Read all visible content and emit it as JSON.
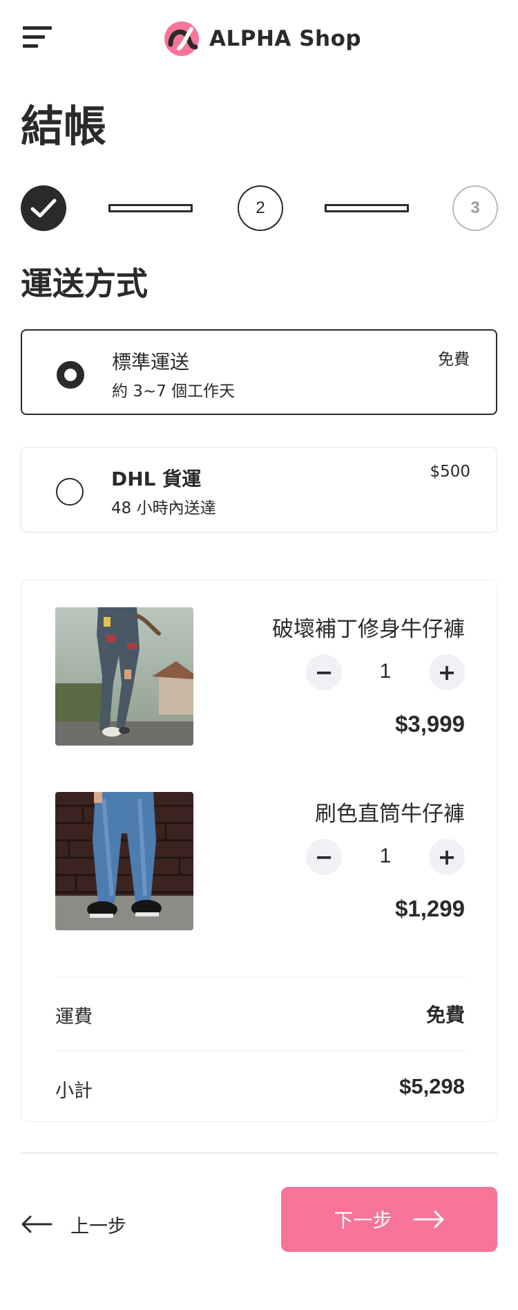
{
  "header": {
    "brand": "ALPHA Shop",
    "menu_icon": "hamburger-menu-icon",
    "logo_icon": "alpha-logo-icon",
    "logo_color": "#f67599"
  },
  "page_title": "結帳",
  "stepper": {
    "steps": [
      {
        "label": "",
        "state": "completed",
        "icon": "check-icon"
      },
      {
        "label": "2",
        "state": "current"
      },
      {
        "label": "3",
        "state": "upcoming"
      }
    ]
  },
  "shipping": {
    "title": "運送方式",
    "options": [
      {
        "name": "標準運送",
        "desc": "約 3~7 個工作天",
        "price": "免費",
        "selected": true
      },
      {
        "name": "DHL 貨運",
        "desc": "48 小時內送達",
        "price": "$500",
        "selected": false
      }
    ]
  },
  "cart": {
    "items": [
      {
        "name": "破壞補丁修身牛仔褲",
        "qty": "1",
        "price": "$3,999",
        "minus": "−",
        "plus": "+"
      },
      {
        "name": "刷色直筒牛仔褲",
        "qty": "1",
        "price": "$1,299",
        "minus": "−",
        "plus": "+"
      }
    ],
    "shipping_label": "運費",
    "shipping_value": "免費",
    "subtotal_label": "小計",
    "subtotal_value": "$5,298"
  },
  "nav": {
    "prev_label": "上一步",
    "next_label": "下一步",
    "prev_icon": "arrow-left-icon",
    "next_icon": "arrow-right-icon",
    "accent": "#f67599"
  }
}
